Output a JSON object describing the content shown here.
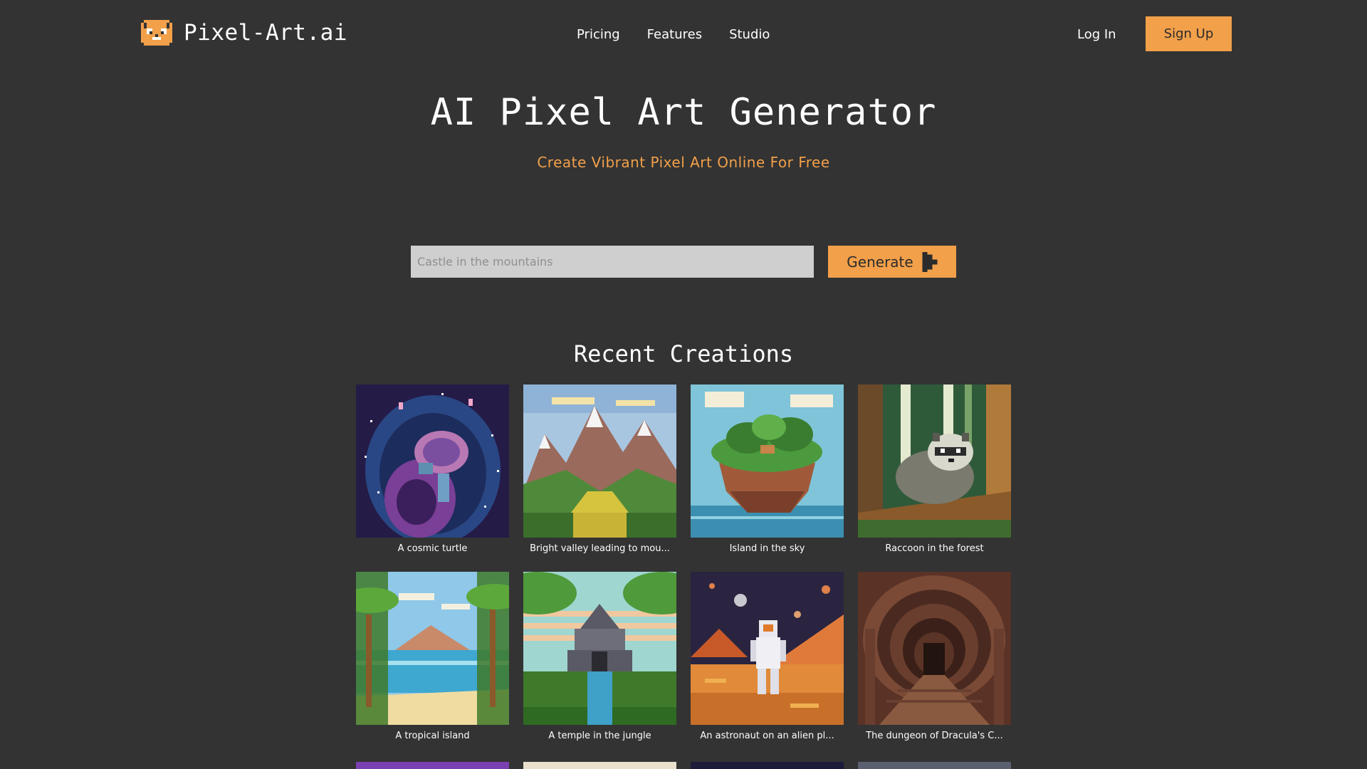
{
  "header": {
    "brand": "Pixel-Art.ai",
    "nav": [
      "Pricing",
      "Features",
      "Studio"
    ],
    "login_label": "Log In",
    "signup_label": "Sign Up"
  },
  "hero": {
    "title": "AI Pixel Art Generator",
    "subtitle": "Create Vibrant Pixel Art Online For Free"
  },
  "prompt": {
    "placeholder": "Castle in the mountains",
    "value": "",
    "generate_label": "Generate"
  },
  "gallery": {
    "title": "Recent Creations",
    "items": [
      {
        "caption": "A cosmic turtle"
      },
      {
        "caption": "Bright valley leading to mou..."
      },
      {
        "caption": "Island in the sky"
      },
      {
        "caption": "Raccoon in the forest"
      },
      {
        "caption": "A tropical island"
      },
      {
        "caption": "A temple in the jungle"
      },
      {
        "caption": "An astronaut on an alien pl..."
      },
      {
        "caption": "The dungeon of Dracula's C..."
      }
    ]
  },
  "colors": {
    "background": "#333333",
    "accent": "#f2a04a",
    "input_bg": "#cfcfcf"
  },
  "icons": {
    "logo": "pixel-cat-logo-icon",
    "generate": "play-arrow-icon"
  }
}
